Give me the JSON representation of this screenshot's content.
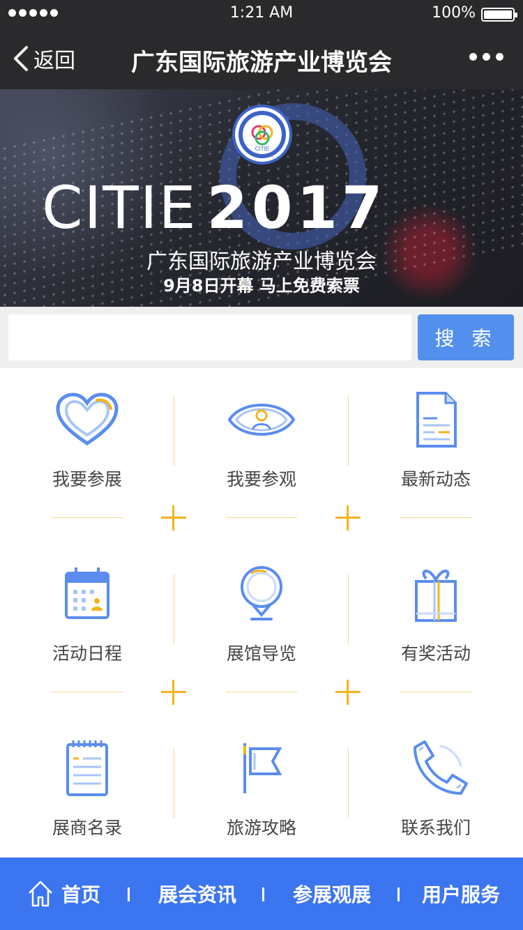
{
  "status_bar": {
    "time": "1:21 AM",
    "battery": "100%"
  },
  "nav": {
    "back_label": "返回",
    "title": "广东国际旅游产业博览会"
  },
  "banner": {
    "brand_light": "CITIE",
    "brand_bold": "2017",
    "subtitle": "广东国际旅游产业博览会",
    "tagline": "9月8日开幕 马上免费索票",
    "logo_text": "CITIE"
  },
  "search": {
    "placeholder": "",
    "value": "",
    "button_label": "搜 索"
  },
  "menu": [
    {
      "label": "我要参展",
      "icon": "heart-icon"
    },
    {
      "label": "我要参观",
      "icon": "eye-icon"
    },
    {
      "label": "最新动态",
      "icon": "document-icon"
    },
    {
      "label": "活动日程",
      "icon": "calendar-icon"
    },
    {
      "label": "展馆导览",
      "icon": "map-pin-icon"
    },
    {
      "label": "有奖活动",
      "icon": "gift-icon"
    },
    {
      "label": "展商名录",
      "icon": "notepad-icon"
    },
    {
      "label": "旅游攻略",
      "icon": "flag-icon"
    },
    {
      "label": "联系我们",
      "icon": "phone-icon"
    }
  ],
  "tabbar": {
    "home": "首页",
    "news": "展会资讯",
    "exhibit": "参展观展",
    "service": "用户服务"
  },
  "colors": {
    "accent": "#3c75f0",
    "search_button": "#5390ee",
    "plus": "#f3b41a",
    "icon_blue": "#5b8def"
  }
}
